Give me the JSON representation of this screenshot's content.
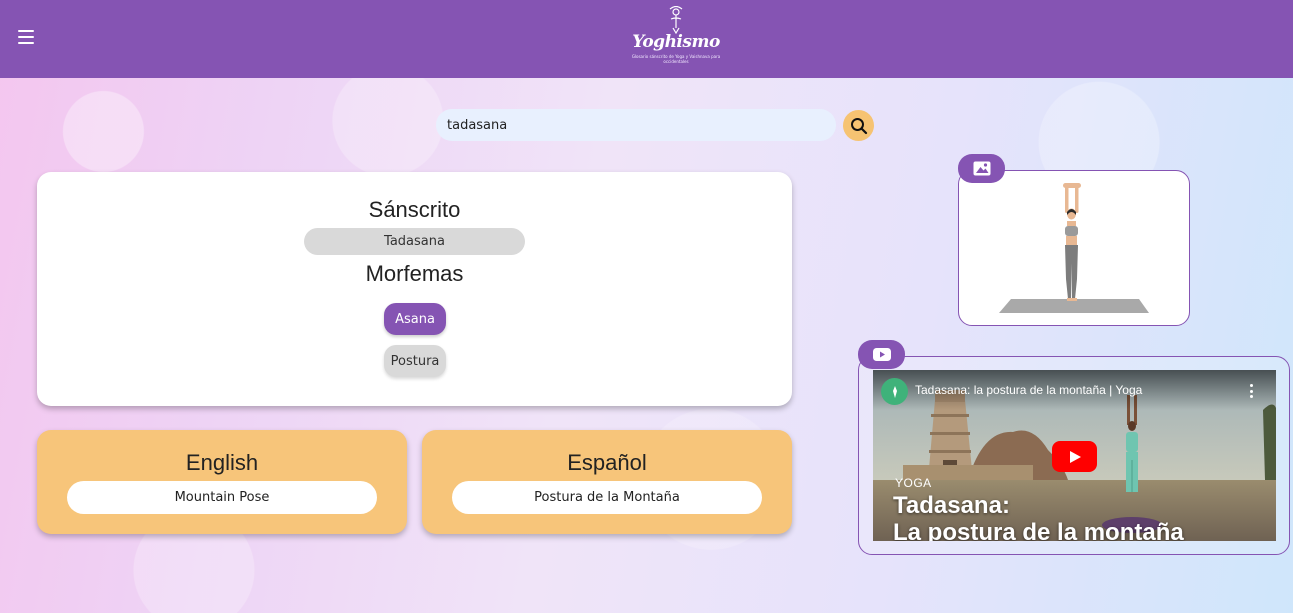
{
  "header": {
    "menu_icon": "hamburger-menu-icon",
    "logo_text": "Yoghismo",
    "logo_tagline": "Glosario sánscrito de Yoga y Vaishnava para occidentales"
  },
  "search": {
    "value": "tadasana",
    "icon": "search-icon"
  },
  "sanskrit_card": {
    "title": "Sánscrito",
    "term": "Tadasana",
    "morphemes_title": "Morfemas",
    "morphemes": [
      {
        "label": "Asana",
        "active": true
      },
      {
        "label": "Postura",
        "active": false
      }
    ]
  },
  "translations": [
    {
      "language": "English",
      "value": "Mountain Pose"
    },
    {
      "language": "Español",
      "value": "Postura de la Montaña"
    }
  ],
  "image_card": {
    "badge_icon": "image-icon"
  },
  "video_card": {
    "badge_icon": "youtube-icon",
    "video_title": "Tadasana: la postura de la montaña | Yoga",
    "category_label": "YOGA",
    "headline_line1": "Tadasana:",
    "headline_line2": "La postura de la montaña"
  },
  "colors": {
    "brand_purple": "#8554b3",
    "accent_orange": "#f7c57a",
    "youtube_red": "#ff0000"
  }
}
